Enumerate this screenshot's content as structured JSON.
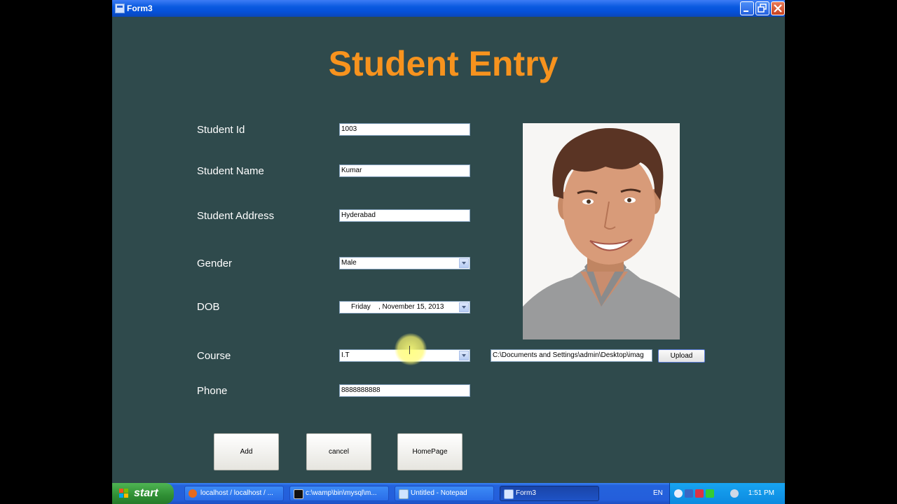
{
  "window": {
    "title": "Form3"
  },
  "form": {
    "heading": "Student Entry",
    "student_id": {
      "label": "Student Id",
      "value": "1003"
    },
    "student_name": {
      "label": "Student Name",
      "value": "Kumar"
    },
    "student_address": {
      "label": "Student Address",
      "value": "Hyderabad"
    },
    "gender": {
      "label": "Gender",
      "selected": "Male"
    },
    "dob": {
      "label": "DOB",
      "day": "Friday",
      "date": ", November 15, 2013"
    },
    "course": {
      "label": "Course",
      "selected": "I.T"
    },
    "phone": {
      "label": "Phone",
      "value": "8888888888"
    },
    "image_path": "C:\\Documents and Settings\\admin\\Desktop\\imag",
    "upload_label": "Upload",
    "buttons": {
      "add": "Add",
      "cancel": "cancel",
      "homepage": "HomePage"
    }
  },
  "taskbar": {
    "start_label": "start",
    "tasks": [
      {
        "label": "localhost / localhost / ...",
        "icon": "firefox-icon"
      },
      {
        "label": "c:\\wamp\\bin\\mysql\\m...",
        "icon": "console-icon"
      },
      {
        "label": "Untitled - Notepad",
        "icon": "notepad-icon"
      },
      {
        "label": "Form3",
        "icon": "form-icon"
      }
    ],
    "language": "EN",
    "clock": "1:51 PM"
  },
  "colors": {
    "form_bg": "#2f4a4c",
    "heading": "#f7931e",
    "titlebar": "#0a5ae0"
  }
}
